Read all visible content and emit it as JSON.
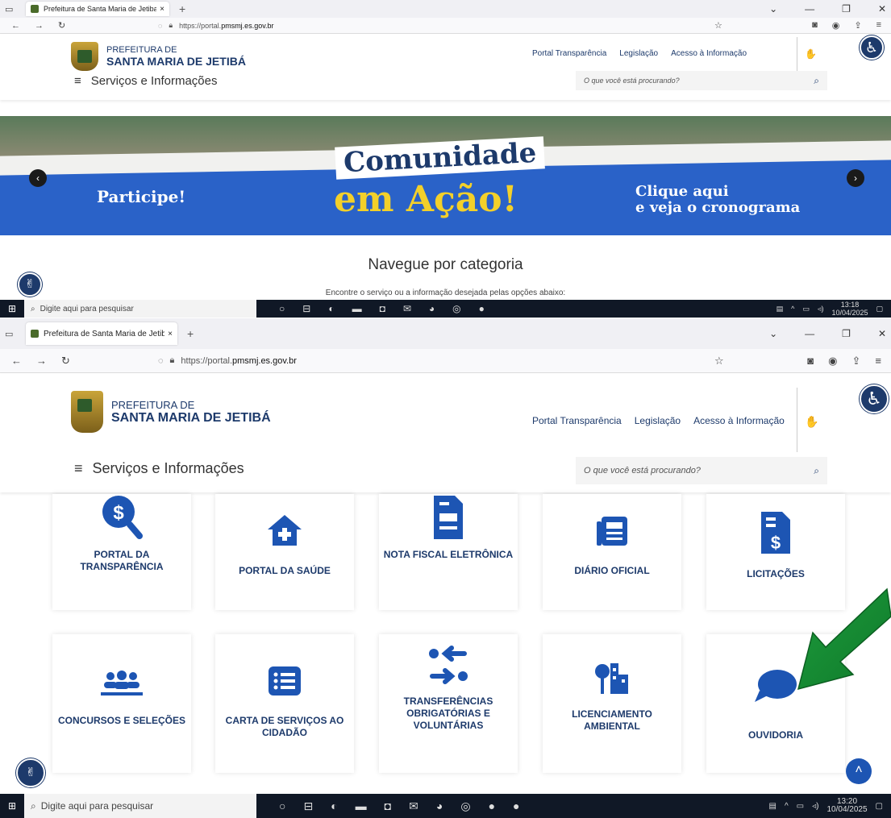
{
  "browser": {
    "tab_title": "Prefeitura de Santa Maria de Jetiba",
    "tab_close": "×",
    "new_tab": "+",
    "url_prefix": "https://portal.",
    "url_domain": "pmsmj.es.gov.br"
  },
  "header": {
    "logo_line1": "PREFEITURA DE",
    "logo_line2": "SANTA MARIA DE JETIBÁ",
    "links": [
      "Portal Transparência",
      "Legislação",
      "Acesso à Informação"
    ],
    "menu_label": "Serviços e Informações",
    "search_placeholder": "O que você está procurando?"
  },
  "banner": {
    "line1": "Comunidade",
    "line2": "em Ação!",
    "left": "Participe!",
    "right1": "Clique aqui",
    "right2": "e veja o cronograma"
  },
  "categories": {
    "title": "Navegue por categoria",
    "subtitle": "Encontre o serviço ou a informação desejada pelas opções abaixo:"
  },
  "taskbar": {
    "search": "Digite aqui para pesquisar",
    "time1": "13:18",
    "date1": "10/04/2025",
    "time2": "13:20",
    "date2": "10/04/2025"
  },
  "cards": [
    {
      "label": "PORTAL DA TRANSPARÊNCIA",
      "icon": "dollar-search-icon"
    },
    {
      "label": "PORTAL DA SAÚDE",
      "icon": "health-house-icon"
    },
    {
      "label": "NOTA FISCAL ELETRÔNICA",
      "icon": "invoice-icon"
    },
    {
      "label": "DIÁRIO OFICIAL",
      "icon": "newspaper-icon"
    },
    {
      "label": "LICITAÇÕES",
      "icon": "bidding-document-icon"
    },
    {
      "label": "CONCURSOS E SELEÇÕES",
      "icon": "people-group-icon"
    },
    {
      "label": "CARTA DE SERVIÇOS AO CIDADÃO",
      "icon": "list-icon"
    },
    {
      "label": "TRANSFERÊNCIAS OBRIGATÓRIAS E VOLUNTÁRIAS",
      "icon": "transfer-arrows-icon"
    },
    {
      "label": "LICENCIAMENTO AMBIENTAL",
      "icon": "tree-building-icon"
    },
    {
      "label": "OUVIDORIA",
      "icon": "speech-bubble-icon"
    }
  ],
  "colors": {
    "primary": "#1d55b3",
    "navy": "#1d3a6b",
    "arrow": "#1a9a3a"
  }
}
